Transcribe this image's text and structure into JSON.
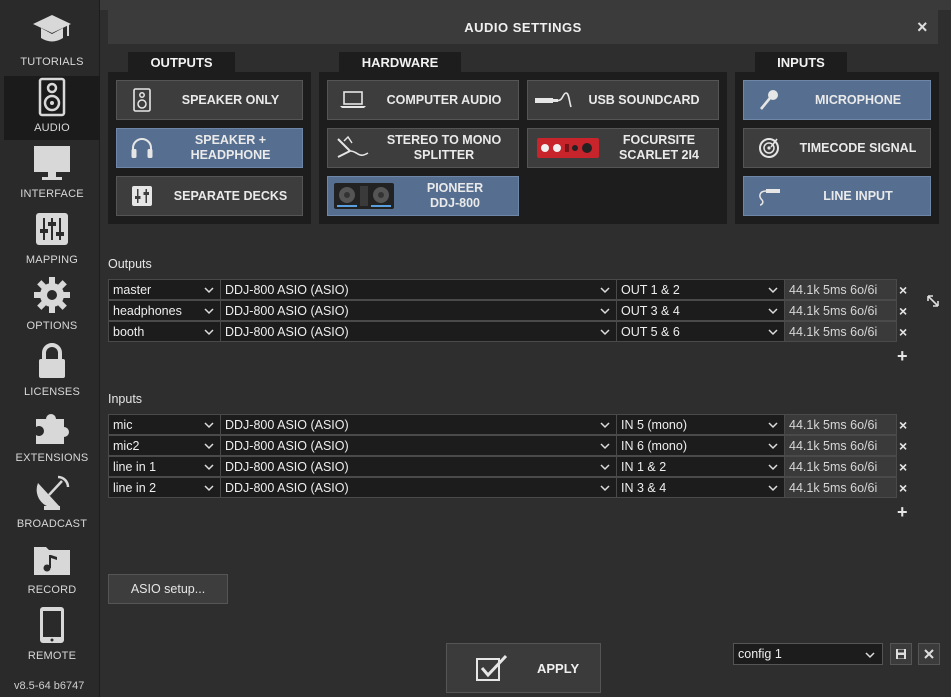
{
  "sidebar": {
    "items": [
      {
        "label": "TUTORIALS",
        "icon": "graduation-cap-icon"
      },
      {
        "label": "AUDIO",
        "icon": "speaker-icon"
      },
      {
        "label": "INTERFACE",
        "icon": "monitor-icon"
      },
      {
        "label": "MAPPING",
        "icon": "sliders-icon"
      },
      {
        "label": "OPTIONS",
        "icon": "gear-icon"
      },
      {
        "label": "LICENSES",
        "icon": "lock-icon"
      },
      {
        "label": "EXTENSIONS",
        "icon": "puzzle-icon"
      },
      {
        "label": "BROADCAST",
        "icon": "satellite-dish-icon"
      },
      {
        "label": "RECORD",
        "icon": "music-folder-icon"
      },
      {
        "label": "REMOTE",
        "icon": "tablet-icon"
      }
    ],
    "active": "AUDIO",
    "version": "v8.5-64 b6747"
  },
  "dialog": {
    "title": "AUDIO SETTINGS",
    "close": "×"
  },
  "tabs": {
    "outputs": "OUTPUTS",
    "hardware": "HARDWARE",
    "inputs": "INPUTS"
  },
  "outputs_buttons": [
    {
      "label": "SPEAKER ONLY",
      "icon": "speaker-icon",
      "selected": false
    },
    {
      "label": "SPEAKER +\nHEADPHONE",
      "icon": "headphones-icon",
      "selected": true
    },
    {
      "label": "SEPARATE DECKS",
      "icon": "mixer-icon",
      "selected": false
    }
  ],
  "hardware_buttons": [
    {
      "label": "COMPUTER AUDIO",
      "icon": "laptop-icon",
      "selected": false
    },
    {
      "label": "USB SOUNDCARD",
      "icon": "usb-cable-icon",
      "selected": false
    },
    {
      "label": "STEREO TO MONO\nSPLITTER",
      "icon": "splitter-cable-icon",
      "selected": false
    },
    {
      "label": "FOCURSITE\nSCARLET 2I4",
      "icon": "audio-interface-icon",
      "selected": false
    },
    {
      "label": "PIONEER\nDDJ-800",
      "icon": "dj-controller-icon",
      "selected": true
    }
  ],
  "inputs_buttons": [
    {
      "label": "MICROPHONE",
      "icon": "microphone-icon",
      "selected": true
    },
    {
      "label": "TIMECODE SIGNAL",
      "icon": "vinyl-icon",
      "selected": false
    },
    {
      "label": "LINE INPUT",
      "icon": "line-cable-icon",
      "selected": true
    }
  ],
  "outputs_section": {
    "label": "Outputs",
    "rows": [
      {
        "name": "master",
        "device": "DDJ-800 ASIO (ASIO)",
        "channel": "OUT 1 & 2",
        "info": "44.1k 5ms 6o/6i"
      },
      {
        "name": "headphones",
        "device": "DDJ-800 ASIO (ASIO)",
        "channel": "OUT 3 & 4",
        "info": "44.1k 5ms 6o/6i"
      },
      {
        "name": "booth",
        "device": "DDJ-800 ASIO (ASIO)",
        "channel": "OUT 5 & 6",
        "info": "44.1k 5ms 6o/6i"
      }
    ]
  },
  "inputs_section": {
    "label": "Inputs",
    "rows": [
      {
        "name": "mic",
        "device": "DDJ-800 ASIO (ASIO)",
        "channel": "IN 5 (mono)",
        "info": "44.1k 5ms 6o/6i"
      },
      {
        "name": "mic2",
        "device": "DDJ-800 ASIO (ASIO)",
        "channel": "IN 6 (mono)",
        "info": "44.1k 5ms 6o/6i"
      },
      {
        "name": "line in 1",
        "device": "DDJ-800 ASIO (ASIO)",
        "channel": "IN 1 & 2",
        "info": "44.1k 5ms 6o/6i"
      },
      {
        "name": "line in 2",
        "device": "DDJ-800 ASIO (ASIO)",
        "channel": "IN 3 & 4",
        "info": "44.1k 5ms 6o/6i"
      }
    ]
  },
  "row_remove": "×",
  "row_add": "+",
  "asio_setup": "ASIO setup...",
  "apply": "APPLY",
  "config": {
    "value": "config 1"
  },
  "colors": {
    "selected": "#566f90",
    "panel": "#1d1d1d",
    "background": "#2e2e2e"
  }
}
